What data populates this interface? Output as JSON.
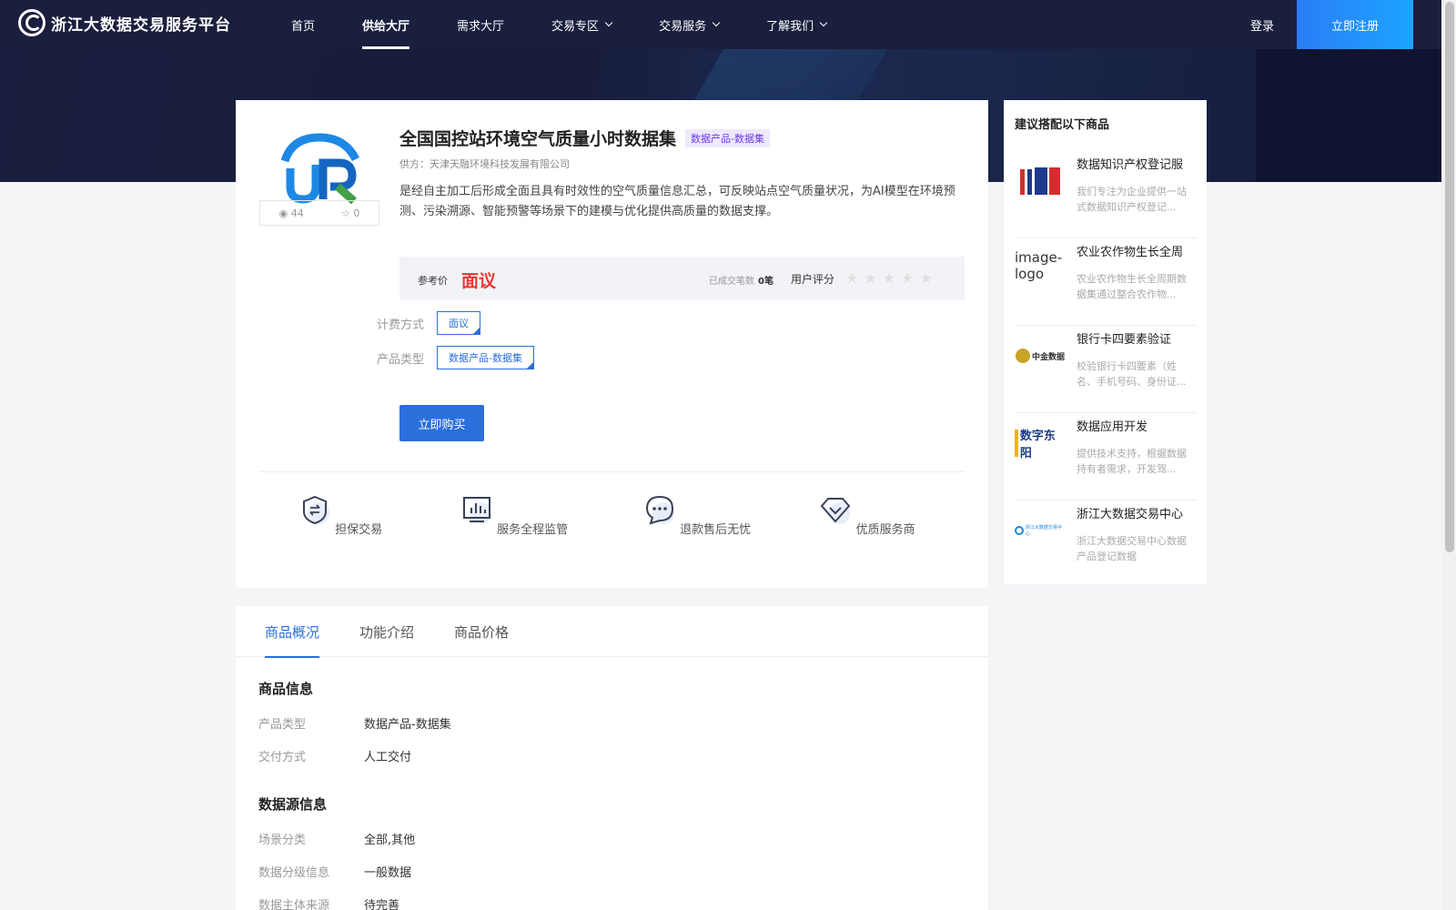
{
  "header": {
    "logo_text": "浙江大数据交易服务平台",
    "nav": [
      {
        "label": "首页",
        "dropdown": false,
        "active": false
      },
      {
        "label": "供给大厅",
        "dropdown": false,
        "active": true
      },
      {
        "label": "需求大厅",
        "dropdown": false,
        "active": false
      },
      {
        "label": "交易专区",
        "dropdown": true,
        "active": false
      },
      {
        "label": "交易服务",
        "dropdown": true,
        "active": false
      },
      {
        "label": "了解我们",
        "dropdown": true,
        "active": false
      }
    ],
    "login": "登录",
    "register": "立即注册"
  },
  "product": {
    "title": "全国国控站环境空气质量小时数据集",
    "category_tag": "数据产品-数据集",
    "supplier": "供方：天津天融环境科技发展有限公司",
    "description": "是经自主加工后形成全面且具有时效性的空气质量信息汇总，可反映站点空气质量状况，为AI模型在环境预测、污染溯源、智能预警等场景下的建模与优化提供高质量的数据支撑。",
    "views": "44",
    "favorites": "0",
    "price_label": "参考价",
    "price": "面议",
    "deals_label": "已成交笔数",
    "deals_value": "0笔",
    "rating_label": "用户评分",
    "rating": 0,
    "rating_max": 5,
    "billing_label": "计费方式",
    "billing_value": "面议",
    "type_label": "产品类型",
    "type_value": "数据产品-数据集",
    "buy_button": "立即购买"
  },
  "features": [
    {
      "label": "担保交易",
      "icon": "shield-exchange-icon"
    },
    {
      "label": "服务全程监管",
      "icon": "monitor-chart-icon"
    },
    {
      "label": "退款售后无忧",
      "icon": "chat-bubble-icon"
    },
    {
      "label": "优质服务商",
      "icon": "diamond-icon"
    }
  ],
  "tabs": [
    "商品概况",
    "功能介绍",
    "商品价格"
  ],
  "details": {
    "section1_title": "商品信息",
    "section1_rows": [
      {
        "label": "产品类型",
        "value": "数据产品-数据集"
      },
      {
        "label": "交付方式",
        "value": "人工交付"
      }
    ],
    "section2_title": "数据源信息",
    "section2_rows": [
      {
        "label": "场景分类",
        "value": "全部,其他"
      },
      {
        "label": "数据分级信息",
        "value": "一般数据"
      },
      {
        "label": "数据主体来源",
        "value": "待完善"
      }
    ]
  },
  "side": {
    "title": "建议搭配以下商品",
    "items": [
      {
        "name": "数据知识产权登记服",
        "desc": "我们专注为企业提供一站式数据知识产权登记...",
        "img_text": "iIR"
      },
      {
        "name": "农业农作物生长全周",
        "desc": "农业农作物生长全周期数据集通过整合农作物...",
        "img_text": "image-logo"
      },
      {
        "name": "银行卡四要素验证",
        "desc": "校验银行卡四要素（姓名、手机号码、身份证...",
        "img_text": "中金数据"
      },
      {
        "name": "数据应用开发",
        "desc": "提供技术支持，根据数据持有者需求，开发驾...",
        "img_text": "数字东阳"
      },
      {
        "name": "浙江大数据交易中心",
        "desc": "浙江大数据交易中心数据产品登记数据",
        "img_text": "浙江大数据交易中心"
      }
    ]
  },
  "colors": {
    "accent": "#2a6fdb",
    "price": "#e53935",
    "header": "#1a1f3d",
    "tag_purple": "#6a3de8"
  }
}
